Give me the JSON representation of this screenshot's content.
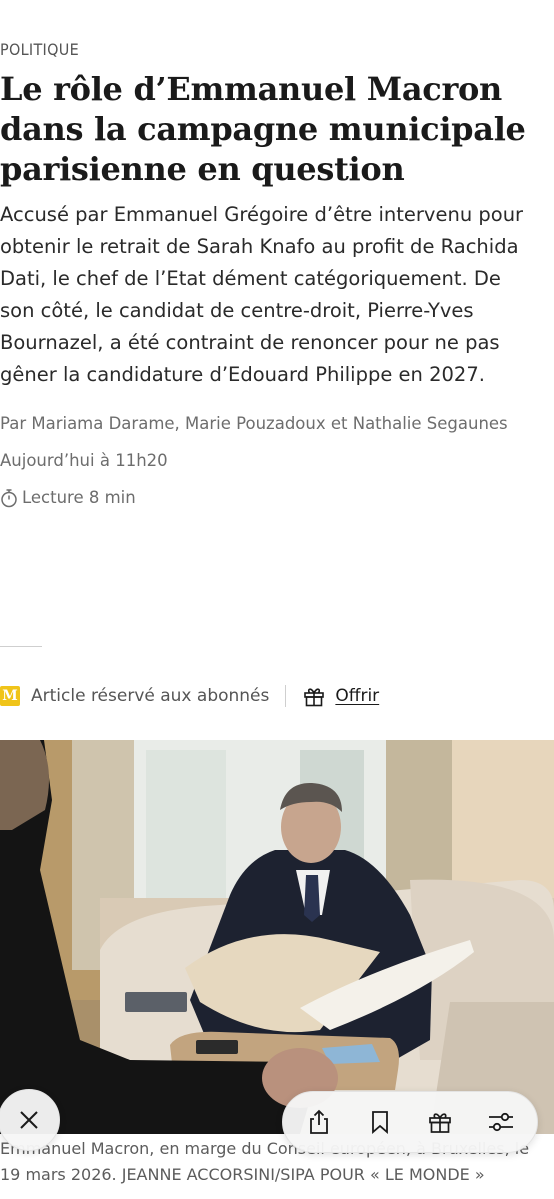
{
  "article": {
    "kicker": "POLITIQUE",
    "headline": "Le rôle d’Emmanuel Macron dans la campagne municipale parisienne en question",
    "lede": "Accusé par Emmanuel Grégoire d’être intervenu pour obtenir le retrait de Sarah Knafo au profit de Rachida Dati, le chef de l’Etat dément catégoriquement. De son côté, le candidat de centre-droit, Pierre-Yves Bournazel, a été contraint de renoncer pour ne pas gêner la candidature d’Edouard Philippe en 2027.",
    "byline": "Par Mariama Darame, Marie Pouzadoux et Nathalie Segaunes",
    "date": "Aujourd’hui à 11h20",
    "reading_time": "Lecture 8 min"
  },
  "subscriber": {
    "badge_letter": "M",
    "label": "Article réservé aux abonnés",
    "offer_label": "Offrir"
  },
  "photo": {
    "caption": "Emmanuel Macron, en marge du Conseil européen, à Bruxelles, le 19 mars 2026. JEANNE ACCORSINI/SIPA POUR « LE MONDE »"
  },
  "toolbar": {
    "icons": [
      "close-icon",
      "share-icon",
      "bookmark-icon",
      "gift-icon",
      "settings-sliders-icon"
    ]
  },
  "colors": {
    "badge": "#f0c419",
    "text": "#1a1a1a",
    "muted": "#6d6d6d"
  }
}
